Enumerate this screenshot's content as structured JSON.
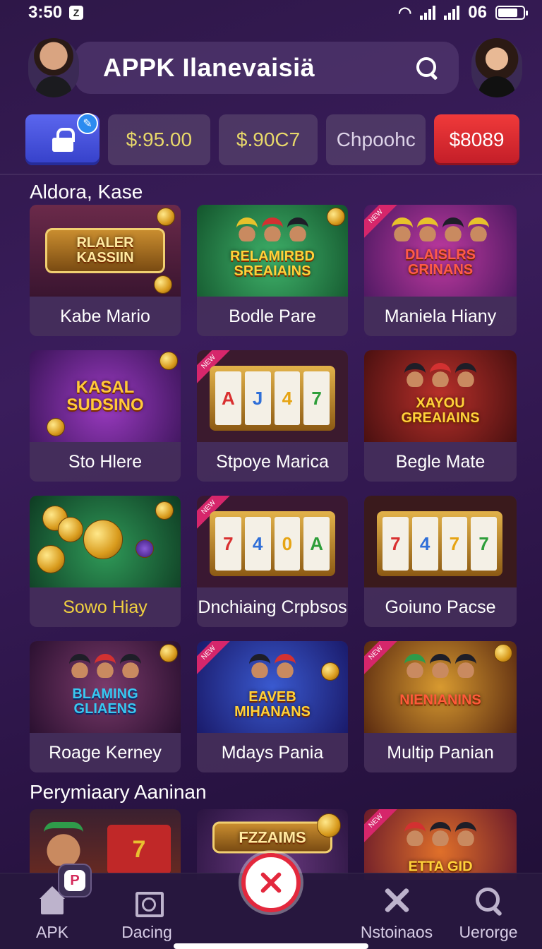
{
  "status": {
    "time": "3:50",
    "notif": "Z",
    "right_text": "06"
  },
  "header": {
    "title": "APPK Ilanevaisiä"
  },
  "wallet": {
    "chips": [
      "$:95.00",
      "$.90C7",
      "Chpoohc",
      "$8089"
    ]
  },
  "section1": {
    "title": "Aldora, Kase"
  },
  "games": [
    {
      "label": "Kabe Mario",
      "banner": "RLALER\nKASSIIN"
    },
    {
      "label": "Bodle Pare",
      "banner": "RELAMIRBD\nSREAIAINS"
    },
    {
      "label": "Maniela Hiany",
      "banner": "DLAISLRS\nGRINANS"
    },
    {
      "label": "Sto Hlere",
      "banner": "KASAL\nSUDSINO"
    },
    {
      "label": "Stpoye Marica",
      "banner": ""
    },
    {
      "label": "Begle Mate",
      "banner": "XAYOU\nGREAIAINS"
    },
    {
      "label": "Sowo Hiay",
      "banner": ""
    },
    {
      "label": "Dnchiaing Crpbsos",
      "banner": ""
    },
    {
      "label": "Goiuno Pacse",
      "banner": ""
    },
    {
      "label": "Roage Kerney",
      "banner": "BLAMING\nGLIAENS"
    },
    {
      "label": "Mdays Pania",
      "banner": "EAVEB\nMIHANANS"
    },
    {
      "label": "Multip Panian",
      "banner": "NIENIANINS"
    }
  ],
  "reels_1": [
    "A",
    "J",
    "4",
    "7"
  ],
  "reels_2": [
    "7",
    "4",
    "0",
    "A"
  ],
  "reels_3": [
    "7",
    "4",
    "7",
    "7"
  ],
  "section2": {
    "title": "Perymiaary Aaninan"
  },
  "bottom_banners": [
    "",
    "FZZAIMS",
    "ETTA GID"
  ],
  "tabs": [
    "APK",
    "Dacing",
    "Nstoinaos",
    "Uerorge"
  ],
  "colors": {
    "accent_red": "#e3283d",
    "lock_blue": "#4751de",
    "gold": "#e8d86a"
  }
}
